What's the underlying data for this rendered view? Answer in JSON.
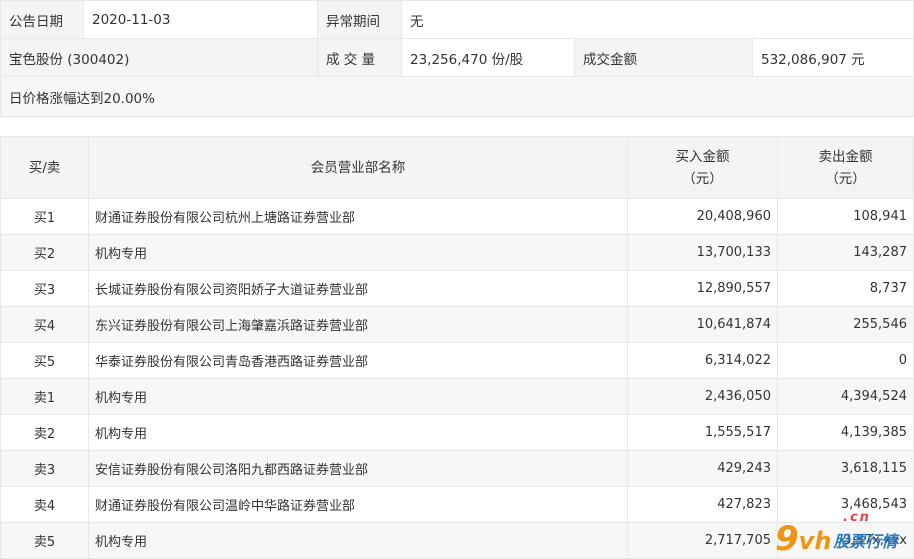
{
  "info": {
    "announce_label": "公告日期",
    "announce_date": "2020-11-03",
    "abnormal_label": "异常期间",
    "abnormal_value": "无",
    "stock_name": "宝色股份 (300402)",
    "volume_label": "成 交 量",
    "volume_value": "23,256,470 份/股",
    "amount_label": "成交金额",
    "amount_value": "532,086,907 元",
    "note": "日价格涨幅达到20.00%"
  },
  "table": {
    "headers": {
      "side": "买/卖",
      "dept": "会员营业部名称",
      "buy_line1": "买入金额",
      "buy_line2": "（元）",
      "sell_line1": "卖出金额",
      "sell_line2": "（元）"
    },
    "rows": [
      {
        "side": "买1",
        "dept": "财通证券股份有限公司杭州上塘路证券营业部",
        "buy": "20,408,960",
        "sell": "108,941"
      },
      {
        "side": "买2",
        "dept": "机构专用",
        "buy": "13,700,133",
        "sell": "143,287"
      },
      {
        "side": "买3",
        "dept": "长城证券股份有限公司资阳娇子大道证券营业部",
        "buy": "12,890,557",
        "sell": "8,737"
      },
      {
        "side": "买4",
        "dept": "东兴证券股份有限公司上海肇嘉浜路证券营业部",
        "buy": "10,641,874",
        "sell": "255,546"
      },
      {
        "side": "买5",
        "dept": "华泰证券股份有限公司青岛香港西路证券营业部",
        "buy": "6,314,022",
        "sell": "0"
      },
      {
        "side": "卖1",
        "dept": "机构专用",
        "buy": "2,436,050",
        "sell": "4,394,524"
      },
      {
        "side": "卖2",
        "dept": "机构专用",
        "buy": "1,555,517",
        "sell": "4,139,385"
      },
      {
        "side": "卖3",
        "dept": "安信证券股份有限公司洛阳九都西路证券营业部",
        "buy": "429,243",
        "sell": "3,618,115"
      },
      {
        "side": "卖4",
        "dept": "财通证券股份有限公司温岭中华路证券营业部",
        "buy": "427,823",
        "sell": "3,468,543"
      },
      {
        "side": "卖5",
        "dept": "机构专用",
        "buy": "2,717,705",
        "sell": "3,37x,xxx"
      }
    ]
  },
  "watermark": {
    "nine": "9",
    "vh": "vh",
    "cn": ".cn",
    "name": "股票行情"
  }
}
